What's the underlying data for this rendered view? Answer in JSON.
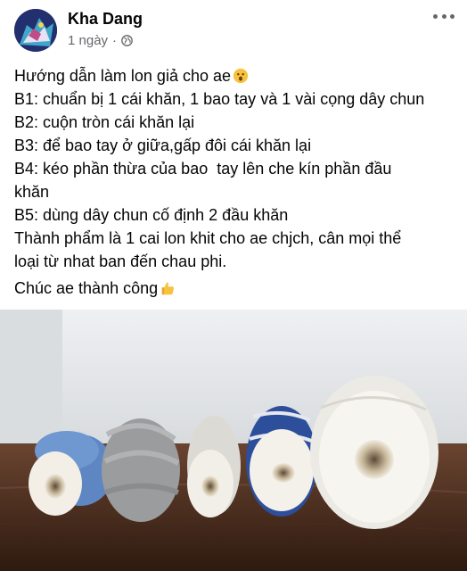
{
  "post": {
    "author": "Kha Dang",
    "time": "1 ngày",
    "separator": "·",
    "privacy_icon": "globe-icon",
    "more_icon": "more-horizontal-icon"
  },
  "content": {
    "lines": [
      "Hướng dẫn làm lon giả cho ae",
      "B1: chuẩn bị 1 cái khăn, 1 bao tay và 1 vài cọng dây chun",
      "B2: cuộn tròn cái khăn lại",
      "B3: để bao tay ở giữa,gấp đôi cái khăn lại",
      "B4: kéo phần thừa của bao  tay lên che kín phần đầu",
      "khăn",
      "B5: dùng dây chun cố định 2 đầu khăn",
      "Thành phẩm là 1 cai lon khit cho ae chjch, cân mọi thể",
      "loại từ nhat ban đến chau phi.",
      "Chúc ae thành công"
    ],
    "emoji_1": "surprised-face-emoji",
    "emoji_2": "thumbs-up-emoji"
  },
  "photo": {
    "subject": "rolled-towel-objects-photo"
  }
}
